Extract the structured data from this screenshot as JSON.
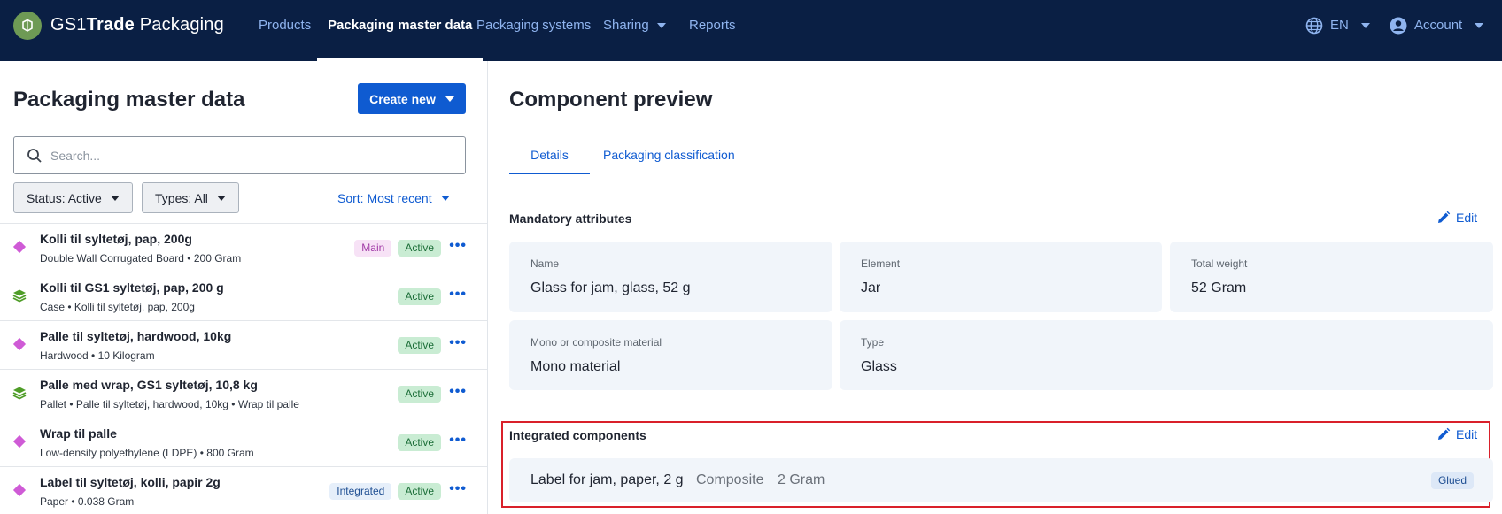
{
  "header": {
    "brand_prefix": "GS1",
    "brand_bold": "Trade",
    "brand_suffix": " Packaging",
    "nav": [
      {
        "label": "Products",
        "active": false
      },
      {
        "label": "Packaging master data",
        "active": true
      },
      {
        "label": "Packaging systems",
        "active": false
      },
      {
        "label": "Sharing",
        "active": false,
        "dropdown": true
      },
      {
        "label": "Reports",
        "active": false
      }
    ],
    "language": "EN",
    "account": "Account"
  },
  "left": {
    "title": "Packaging master data",
    "create_button": "Create new",
    "search_placeholder": "Search...",
    "status_filter": "Status: Active",
    "types_filter": "Types: All",
    "sort": "Sort: Most recent",
    "items": [
      {
        "title": "Kolli til syltetøj, pap, 200g",
        "subtitle": "Double Wall Corrugated Board • 200 Gram",
        "icon": "diamond-icon",
        "tag": "Main",
        "status": "Active"
      },
      {
        "title": "Kolli til GS1 syltetøj, pap, 200 g",
        "subtitle": "Case • Kolli til syltetøj, pap, 200g",
        "icon": "layers-icon",
        "tag": "",
        "status": "Active"
      },
      {
        "title": "Palle til syltetøj, hardwood, 10kg",
        "subtitle": "Hardwood • 10 Kilogram",
        "icon": "diamond-icon",
        "tag": "",
        "status": "Active"
      },
      {
        "title": "Palle med wrap, GS1 syltetøj, 10,8 kg",
        "subtitle": "Pallet • Palle til syltetøj, hardwood, 10kg • Wrap til palle",
        "icon": "layers-icon",
        "tag": "",
        "status": "Active"
      },
      {
        "title": "Wrap til palle",
        "subtitle": "Low-density polyethylene (LDPE) • 800 Gram",
        "icon": "diamond-icon",
        "tag": "",
        "status": "Active"
      },
      {
        "title": "Label til syltetøj, kolli, papir 2g",
        "subtitle": "Paper • 0.038 Gram",
        "icon": "diamond-icon",
        "tag": "Integrated",
        "status": "Active"
      }
    ]
  },
  "right": {
    "title": "Component preview",
    "tabs": [
      "Details",
      "Packaging classification"
    ],
    "mandatory_label": "Mandatory attributes",
    "edit_label": "Edit",
    "attributes": {
      "name": {
        "label": "Name",
        "value": "Glass for jam, glass, 52 g"
      },
      "element": {
        "label": "Element",
        "value": "Jar"
      },
      "total_weight": {
        "label": "Total weight",
        "value": "52 Gram"
      },
      "material": {
        "label": "Mono or composite material",
        "value": "Mono material"
      },
      "type": {
        "label": "Type",
        "value": "Glass"
      }
    },
    "integrated": {
      "label": "Integrated components",
      "edit_label": "Edit",
      "component": {
        "name": "Label for jam, paper, 2 g",
        "type": "Composite",
        "weight": "2 Gram",
        "badge": "Glued"
      }
    }
  },
  "colors": {
    "nav_bg": "#0a1f44",
    "accent": "#0f5bd1",
    "active_badge": "#c9ecd3",
    "highlight_border": "#d9202a"
  }
}
